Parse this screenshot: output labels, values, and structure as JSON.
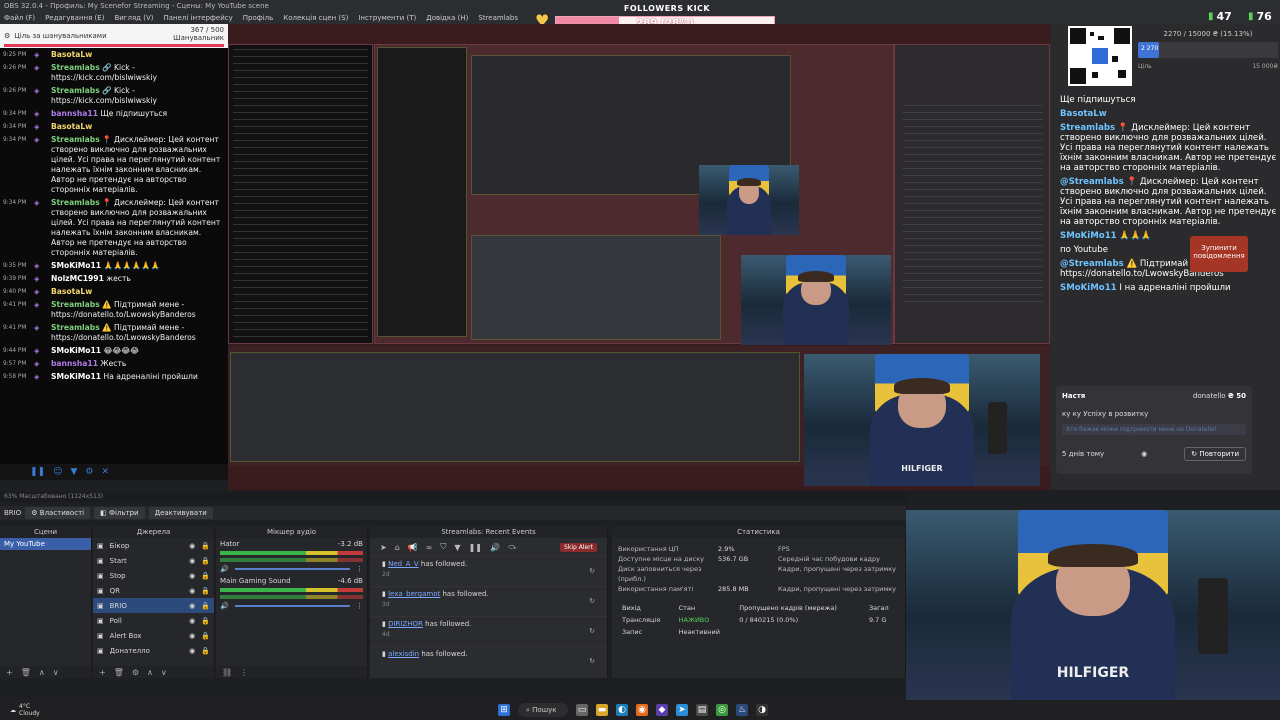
{
  "window": {
    "title": "OBS 32.0.4 - Профиль: My Scenefor Streaming - Сцены: My YouTube scene",
    "menu": [
      "Файл (F)",
      "Редагування (E)",
      "Вигляд (V)",
      "Панелі інтерфейсу",
      "Профіль",
      "Колекція сцен (S)",
      "Інструменти (T)",
      "Довідка (H)",
      "Streamlabs"
    ]
  },
  "follower_goal": {
    "title": "FOLLOWERS KICK",
    "progress_text": "289 (28%)",
    "progress": 0.289,
    "min": "0",
    "max": "1000"
  },
  "viewers": {
    "count_a": "47",
    "count_b": "76"
  },
  "left_chat": {
    "goal_label": "Ціль за шанувальниками",
    "goal_count": "367 / 500",
    "goal_sub": "Шанувальник",
    "messages": [
      {
        "time": "9:25 PM",
        "name": "BasotaLw",
        "color": "#f5d76e",
        "text": ""
      },
      {
        "time": "9:26 PM",
        "name": "Streamlabs",
        "color": "#7fd07f",
        "text": "🔗 Kick - https://kick.com/bislwiwskiy"
      },
      {
        "time": "9:26 PM",
        "name": "Streamlabs",
        "color": "#7fd07f",
        "text": "🔗 Kick - https://kick.com/bislwiwskiy"
      },
      {
        "time": "9:34 PM",
        "name": "bannsha11",
        "color": "#b07be8",
        "text": "Ще підпишуться"
      },
      {
        "time": "9:34 PM",
        "name": "BasotaLw",
        "color": "#f5d76e",
        "text": ""
      },
      {
        "time": "9:34 PM",
        "name": "Streamlabs",
        "color": "#7fd07f",
        "text": "📍 Дисклеймер: Цей контент створено виключно для розважальних цілей. Усі права на переглянутий контент належать їхнім законним власникам. Автор не претендує на авторство сторонніх матеріалів."
      },
      {
        "time": "9:34 PM",
        "name": "Streamlabs",
        "color": "#7fd07f",
        "text": "📍 Дисклеймер: Цей контент створено виключно для розважальних цілей. Усі права на переглянутий контент належать їхнім законним власникам. Автор не претендує на авторство сторонніх матеріалів."
      },
      {
        "time": "9:35 PM",
        "name": "SMoKiMo11",
        "color": "#fff",
        "text": "🙏🙏🙏🙏🙏🙏"
      },
      {
        "time": "9:39 PM",
        "name": "NolzMC1991",
        "color": "#fff",
        "text": "жесть"
      },
      {
        "time": "9:40 PM",
        "name": "BasotaLw",
        "color": "#f5d76e",
        "text": ""
      },
      {
        "time": "9:41 PM",
        "name": "Streamlabs",
        "color": "#7fd07f",
        "text": "⚠️ Підтримай мене - https://donatello.to/LwowskyBanderos"
      },
      {
        "time": "9:41 PM",
        "name": "Streamlabs",
        "color": "#7fd07f",
        "text": "⚠️ Підтримай мене - https://donatello.to/LwowskyBanderos"
      },
      {
        "time": "9:44 PM",
        "name": "SMoKiMo11",
        "color": "#fff",
        "text": "😂😂😂😂"
      },
      {
        "time": "9:57 PM",
        "name": "bannsha11",
        "color": "#b07be8",
        "text": "Жесть"
      },
      {
        "time": "9:58 PM",
        "name": "SMoKiMo11",
        "color": "#fff",
        "text": "На адреналіні пройшли"
      }
    ]
  },
  "donation_goal": {
    "text": "2270 / 15000 ₴ (15.13%)",
    "value": "2 270",
    "progress": 0.1513,
    "min": "Ціль",
    "max": "15 000₴"
  },
  "right_chat": [
    {
      "name": "",
      "text": "Ще підпишуться"
    },
    {
      "name": "BasotaLw",
      "text": ""
    },
    {
      "name": "Streamlabs",
      "text": "📍 Дисклеймер: Цей контент створено виключно для розважальних цілей. Усі права на переглянутий контент належать їхнім законним власникам. Автор не претендує на авторство сторонніх матеріалів."
    },
    {
      "name": "@Streamlabs",
      "text": "📍 Дисклеймер: Цей контент створено виключно для розважальних цілей. Усі права на переглянутий контент належать їхнім законним власникам. Автор не претендує на авторство сторонніх матеріалів."
    },
    {
      "name": "SMoKiMo11",
      "text": "🙏🙏🙏"
    },
    {
      "name": "",
      "text": "по Youtube"
    },
    {
      "name": "@Streamlabs",
      "text": "⚠️ Підтримай мене - https://donatello.to/LwowskyBanderos"
    },
    {
      "name": "SMoKiMo11",
      "text": "І на адреналіні пройшли"
    }
  ],
  "stop_button": "Зупинити повідомлення",
  "donation_card": {
    "name": "Настя",
    "source": "donatello",
    "amount": "₴ 50",
    "message": "ку ку Успіху в розвитку",
    "placeholder": "Хто бажає можe підтримати мене на Donatello!",
    "age": "5 днів тому",
    "repeat": "Повторити"
  },
  "status_bar": "63% Масштабовано (1124x513)",
  "dock_tabs": {
    "scene": "BRIO",
    "props": "Властивості",
    "filters": "Фільтри",
    "deactivate": "Деактивувати"
  },
  "scenes": {
    "title": "Сцени",
    "items": [
      "My YouTube"
    ]
  },
  "sources": {
    "title": "Джерела",
    "items": [
      "Бікор",
      "Start",
      "Stop",
      "QR",
      "BRIO",
      "Poll",
      "Alert Box",
      "Донателло"
    ]
  },
  "mixer": {
    "title": "Мікшер аудіо",
    "channels": [
      {
        "name": "Hator",
        "db": "-3.2 dB"
      },
      {
        "name": "Main Gaming Sound",
        "db": "-4.6 dB"
      }
    ]
  },
  "events": {
    "title": "Streamlabs: Recent Events",
    "skip": "Skip Alert",
    "items": [
      {
        "user": "Ned_A_V",
        "text": "has followed.",
        "age": "2d"
      },
      {
        "user": "lexa_bergamot",
        "text": "has followed.",
        "age": "3d"
      },
      {
        "user": "DIRIZHOR",
        "text": "has followed.",
        "age": "4d"
      },
      {
        "user": "alexisdin",
        "text": "has followed.",
        "age": ""
      }
    ]
  },
  "stats": {
    "title": "Статистика",
    "rows": [
      {
        "k": "Використання ЦП",
        "v": "2.9%",
        "k2": "FPS"
      },
      {
        "k": "Доступне місце на диску",
        "v": "536.7 GB",
        "k2": "Середній час побудови кадру"
      },
      {
        "k": "Диск заповниться через (прибл.)",
        "v": "",
        "k2": "Кадри, пропущені через затримку"
      },
      {
        "k": "Використання пам'яті",
        "v": "285.8 MB",
        "k2": "Кадри, пропущені через затримку"
      }
    ],
    "table_head": [
      "Вихід",
      "Стан",
      "Пропущено кадрів (мережа)",
      "Загал"
    ],
    "table_rows": [
      [
        "Трансляція",
        "НАЖИВО",
        "0 / 840215 (0.0%)",
        "9.7 G"
      ],
      [
        "Запис",
        "Неактивний",
        "",
        ""
      ]
    ]
  },
  "taskbar": {
    "weather_temp": "4°C",
    "weather_desc": "Cloudy",
    "search": "Пошук"
  },
  "colors": {
    "accent": "#3a5fa8",
    "live": "#5ad05a",
    "stop": "#a53524",
    "goal": "#f08aa6"
  }
}
